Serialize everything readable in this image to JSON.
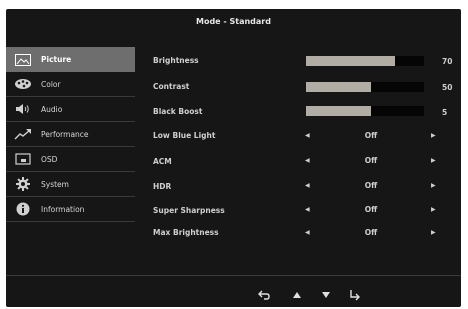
{
  "header": {
    "title": "Mode - Standard"
  },
  "sidebar": {
    "items": [
      {
        "label": "Picture",
        "icon": "picture-icon",
        "active": true
      },
      {
        "label": "Color",
        "icon": "palette-icon",
        "active": false
      },
      {
        "label": "Audio",
        "icon": "speaker-icon",
        "active": false
      },
      {
        "label": "Performance",
        "icon": "trend-up-icon",
        "active": false
      },
      {
        "label": "OSD",
        "icon": "screen-icon",
        "active": false
      },
      {
        "label": "System",
        "icon": "gear-icon",
        "active": false
      },
      {
        "label": "Information",
        "icon": "info-icon",
        "active": false
      }
    ]
  },
  "settings": {
    "brightness": {
      "label": "Brightness",
      "value": "70",
      "level": 0.75
    },
    "contrast": {
      "label": "Contrast",
      "value": "50",
      "level": 0.55
    },
    "black_boost": {
      "label": "Black Boost",
      "value": "5",
      "level": 0.55
    },
    "low_blue_light": {
      "label": "Low Blue Light",
      "value": "Off"
    },
    "acm": {
      "label": "ACM",
      "value": "Off"
    },
    "hdr": {
      "label": "HDR",
      "value": "Off"
    },
    "super_sharpness": {
      "label": "Super Sharpness",
      "value": "Off"
    },
    "max_brightness": {
      "label": "Max Brightness",
      "value": "Off"
    }
  },
  "nav": {
    "icons": [
      "back-icon",
      "up-icon",
      "down-icon",
      "enter-icon"
    ]
  },
  "colors": {
    "background": "#161616",
    "highlight": "#6e6e6e",
    "bar_fill": "#b1aca4",
    "bar_track": "#050505"
  }
}
